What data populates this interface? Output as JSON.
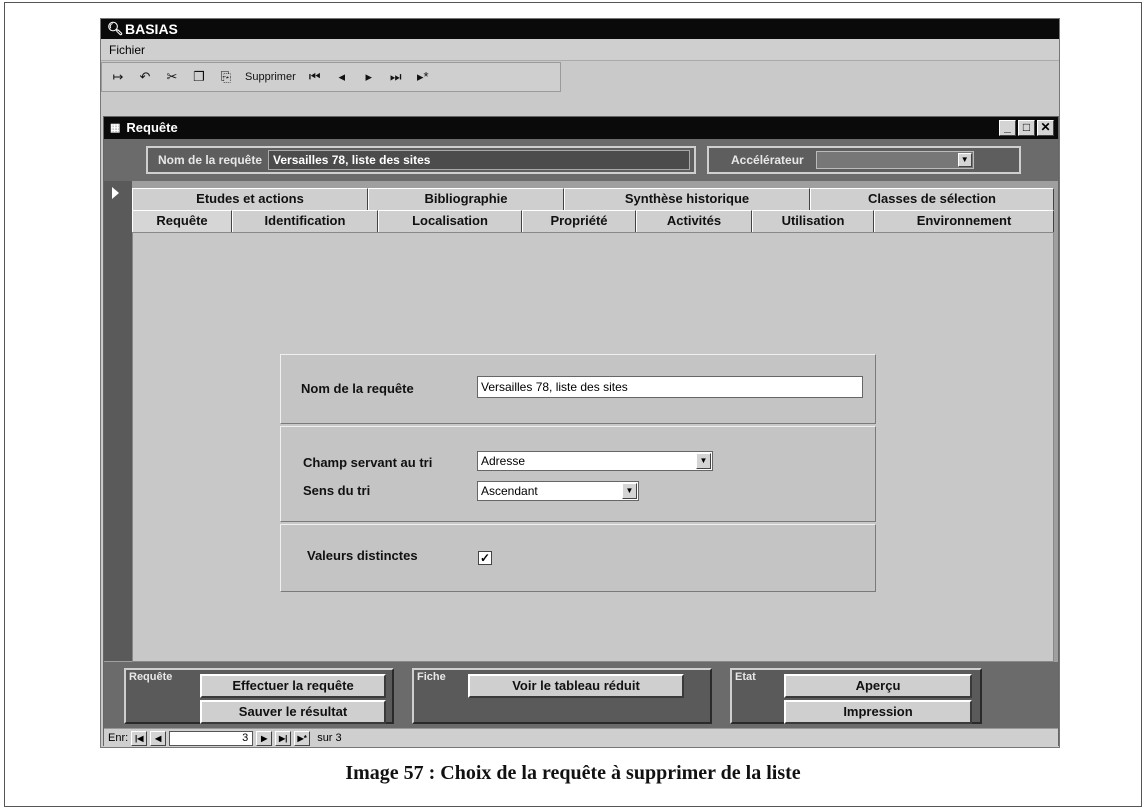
{
  "app": {
    "title": "BASIAS"
  },
  "menu": {
    "items": [
      "Fichier"
    ]
  },
  "toolbar": {
    "delete_label": "Supprimer"
  },
  "window": {
    "title": "Requête"
  },
  "header": {
    "query_name_label": "Nom de la requête",
    "query_name_value": "Versailles 78, liste des sites",
    "accelerator_label": "Accélérateur",
    "accelerator_value": ""
  },
  "tabs": {
    "row1": [
      "Etudes et actions",
      "Bibliographie",
      "Synthèse historique",
      "Classes de sélection"
    ],
    "row2": [
      "Requête",
      "Identification",
      "Localisation",
      "Propriété",
      "Activités",
      "Utilisation",
      "Environnement"
    ],
    "active": "Requête"
  },
  "form": {
    "name_label": "Nom de la requête",
    "name_value": "Versailles 78, liste des sites",
    "sort_field_label": "Champ servant au tri",
    "sort_field_value": "Adresse",
    "sort_order_label": "Sens du tri",
    "sort_order_value": "Ascendant",
    "distinct_label": "Valeurs distinctes",
    "distinct_checked": true
  },
  "footer": {
    "requete_group": "Requête",
    "run_query": "Effectuer la requête",
    "save_result": "Sauver le résultat",
    "fiche_group": "Fiche",
    "view_table": "Voir le tableau réduit",
    "etat_group": "Etat",
    "preview": "Aperçu",
    "print": "Impression"
  },
  "navigation": {
    "label": "Enr:",
    "current": "3",
    "of_label": "sur 3"
  },
  "caption": "Image 57 : Choix de la requête à supprimer de la liste"
}
